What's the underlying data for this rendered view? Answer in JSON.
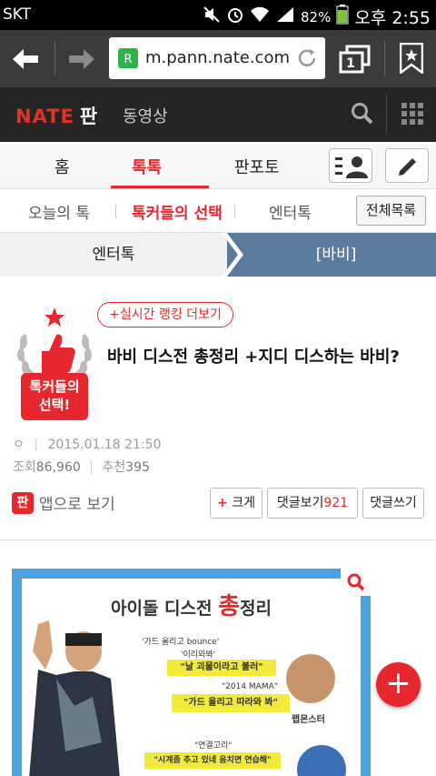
{
  "status_bar": {
    "carrier": "SKT",
    "battery": "82%",
    "time": "오후 2:55"
  },
  "browser": {
    "url": "m.pann.nate.com",
    "tab_count": "1"
  },
  "header": {
    "logo": "NATE",
    "logo_sub": "판",
    "video_label": "동영상"
  },
  "main_tabs": [
    {
      "label": "홈"
    },
    {
      "label": "톡톡"
    },
    {
      "label": "판포토"
    }
  ],
  "sub_tabs": [
    {
      "label": "오늘의 톡"
    },
    {
      "label": "톡커들의 선택"
    },
    {
      "label": "엔터톡"
    }
  ],
  "all_list_label": "전체목록",
  "breadcrumb": {
    "left": "엔터톡",
    "right": "[바비]"
  },
  "post": {
    "ranking_label": "+실시간 랭킹 더보기",
    "badge_line1": "톡커들의",
    "badge_line2": "선택!",
    "title": "바비 디스전 총정리 +지디 디스하는 바비?",
    "author_mark": "ㅇ",
    "datetime": "2015.01.18 21:50",
    "views_label": "조회",
    "views": "86,960",
    "recommend_label": "추천",
    "recommend": "395"
  },
  "actions": {
    "app_view": "앱으로 보기",
    "app_icon_text": "판",
    "enlarge": "크게",
    "comments_label": "댓글보기",
    "comments_count": "921",
    "write_comment": "댓글쓰기"
  },
  "image": {
    "title_prefix": "아이돌 디스전 ",
    "title_emph": "총",
    "title_suffix": "정리",
    "line1a": "'가드 올리고 bounce'",
    "line1b": "'이리와봐'",
    "bubble1": "\"날 괴물이라고 불러\"",
    "line2": "\"2014 MAMA\"",
    "bubble2": "\"가드 올리고 따라와 봐\"",
    "caption_rm": "랩몬스터",
    "line3": "\"연결고리\"",
    "bubble3": "\"시계좀 추고 있네 음치면 연습해\""
  },
  "colors": {
    "accent": "#e6282e",
    "header_bg": "#252525",
    "urlbar_bg": "#3b3b3b",
    "crumb_active": "#5a7a9e",
    "image_frame": "#4aa3e0"
  }
}
